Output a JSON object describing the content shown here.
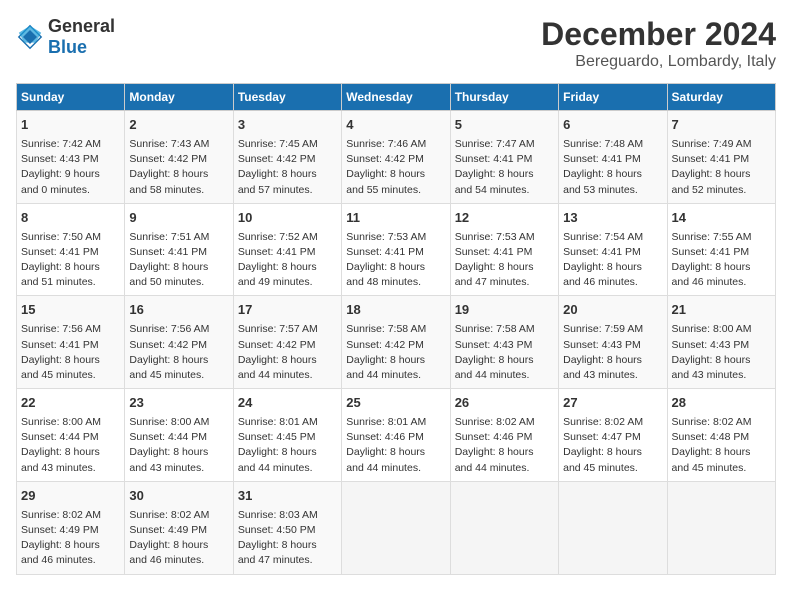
{
  "header": {
    "logo_general": "General",
    "logo_blue": "Blue",
    "month": "December 2024",
    "location": "Bereguardo, Lombardy, Italy"
  },
  "weekdays": [
    "Sunday",
    "Monday",
    "Tuesday",
    "Wednesday",
    "Thursday",
    "Friday",
    "Saturday"
  ],
  "rows": [
    [
      {
        "day": "1",
        "lines": [
          "Sunrise: 7:42 AM",
          "Sunset: 4:43 PM",
          "Daylight: 9 hours",
          "and 0 minutes."
        ]
      },
      {
        "day": "2",
        "lines": [
          "Sunrise: 7:43 AM",
          "Sunset: 4:42 PM",
          "Daylight: 8 hours",
          "and 58 minutes."
        ]
      },
      {
        "day": "3",
        "lines": [
          "Sunrise: 7:45 AM",
          "Sunset: 4:42 PM",
          "Daylight: 8 hours",
          "and 57 minutes."
        ]
      },
      {
        "day": "4",
        "lines": [
          "Sunrise: 7:46 AM",
          "Sunset: 4:42 PM",
          "Daylight: 8 hours",
          "and 55 minutes."
        ]
      },
      {
        "day": "5",
        "lines": [
          "Sunrise: 7:47 AM",
          "Sunset: 4:41 PM",
          "Daylight: 8 hours",
          "and 54 minutes."
        ]
      },
      {
        "day": "6",
        "lines": [
          "Sunrise: 7:48 AM",
          "Sunset: 4:41 PM",
          "Daylight: 8 hours",
          "and 53 minutes."
        ]
      },
      {
        "day": "7",
        "lines": [
          "Sunrise: 7:49 AM",
          "Sunset: 4:41 PM",
          "Daylight: 8 hours",
          "and 52 minutes."
        ]
      }
    ],
    [
      {
        "day": "8",
        "lines": [
          "Sunrise: 7:50 AM",
          "Sunset: 4:41 PM",
          "Daylight: 8 hours",
          "and 51 minutes."
        ]
      },
      {
        "day": "9",
        "lines": [
          "Sunrise: 7:51 AM",
          "Sunset: 4:41 PM",
          "Daylight: 8 hours",
          "and 50 minutes."
        ]
      },
      {
        "day": "10",
        "lines": [
          "Sunrise: 7:52 AM",
          "Sunset: 4:41 PM",
          "Daylight: 8 hours",
          "and 49 minutes."
        ]
      },
      {
        "day": "11",
        "lines": [
          "Sunrise: 7:53 AM",
          "Sunset: 4:41 PM",
          "Daylight: 8 hours",
          "and 48 minutes."
        ]
      },
      {
        "day": "12",
        "lines": [
          "Sunrise: 7:53 AM",
          "Sunset: 4:41 PM",
          "Daylight: 8 hours",
          "and 47 minutes."
        ]
      },
      {
        "day": "13",
        "lines": [
          "Sunrise: 7:54 AM",
          "Sunset: 4:41 PM",
          "Daylight: 8 hours",
          "and 46 minutes."
        ]
      },
      {
        "day": "14",
        "lines": [
          "Sunrise: 7:55 AM",
          "Sunset: 4:41 PM",
          "Daylight: 8 hours",
          "and 46 minutes."
        ]
      }
    ],
    [
      {
        "day": "15",
        "lines": [
          "Sunrise: 7:56 AM",
          "Sunset: 4:41 PM",
          "Daylight: 8 hours",
          "and 45 minutes."
        ]
      },
      {
        "day": "16",
        "lines": [
          "Sunrise: 7:56 AM",
          "Sunset: 4:42 PM",
          "Daylight: 8 hours",
          "and 45 minutes."
        ]
      },
      {
        "day": "17",
        "lines": [
          "Sunrise: 7:57 AM",
          "Sunset: 4:42 PM",
          "Daylight: 8 hours",
          "and 44 minutes."
        ]
      },
      {
        "day": "18",
        "lines": [
          "Sunrise: 7:58 AM",
          "Sunset: 4:42 PM",
          "Daylight: 8 hours",
          "and 44 minutes."
        ]
      },
      {
        "day": "19",
        "lines": [
          "Sunrise: 7:58 AM",
          "Sunset: 4:43 PM",
          "Daylight: 8 hours",
          "and 44 minutes."
        ]
      },
      {
        "day": "20",
        "lines": [
          "Sunrise: 7:59 AM",
          "Sunset: 4:43 PM",
          "Daylight: 8 hours",
          "and 43 minutes."
        ]
      },
      {
        "day": "21",
        "lines": [
          "Sunrise: 8:00 AM",
          "Sunset: 4:43 PM",
          "Daylight: 8 hours",
          "and 43 minutes."
        ]
      }
    ],
    [
      {
        "day": "22",
        "lines": [
          "Sunrise: 8:00 AM",
          "Sunset: 4:44 PM",
          "Daylight: 8 hours",
          "and 43 minutes."
        ]
      },
      {
        "day": "23",
        "lines": [
          "Sunrise: 8:00 AM",
          "Sunset: 4:44 PM",
          "Daylight: 8 hours",
          "and 43 minutes."
        ]
      },
      {
        "day": "24",
        "lines": [
          "Sunrise: 8:01 AM",
          "Sunset: 4:45 PM",
          "Daylight: 8 hours",
          "and 44 minutes."
        ]
      },
      {
        "day": "25",
        "lines": [
          "Sunrise: 8:01 AM",
          "Sunset: 4:46 PM",
          "Daylight: 8 hours",
          "and 44 minutes."
        ]
      },
      {
        "day": "26",
        "lines": [
          "Sunrise: 8:02 AM",
          "Sunset: 4:46 PM",
          "Daylight: 8 hours",
          "and 44 minutes."
        ]
      },
      {
        "day": "27",
        "lines": [
          "Sunrise: 8:02 AM",
          "Sunset: 4:47 PM",
          "Daylight: 8 hours",
          "and 45 minutes."
        ]
      },
      {
        "day": "28",
        "lines": [
          "Sunrise: 8:02 AM",
          "Sunset: 4:48 PM",
          "Daylight: 8 hours",
          "and 45 minutes."
        ]
      }
    ],
    [
      {
        "day": "29",
        "lines": [
          "Sunrise: 8:02 AM",
          "Sunset: 4:49 PM",
          "Daylight: 8 hours",
          "and 46 minutes."
        ]
      },
      {
        "day": "30",
        "lines": [
          "Sunrise: 8:02 AM",
          "Sunset: 4:49 PM",
          "Daylight: 8 hours",
          "and 46 minutes."
        ]
      },
      {
        "day": "31",
        "lines": [
          "Sunrise: 8:03 AM",
          "Sunset: 4:50 PM",
          "Daylight: 8 hours",
          "and 47 minutes."
        ]
      },
      {
        "day": "",
        "lines": []
      },
      {
        "day": "",
        "lines": []
      },
      {
        "day": "",
        "lines": []
      },
      {
        "day": "",
        "lines": []
      }
    ]
  ]
}
